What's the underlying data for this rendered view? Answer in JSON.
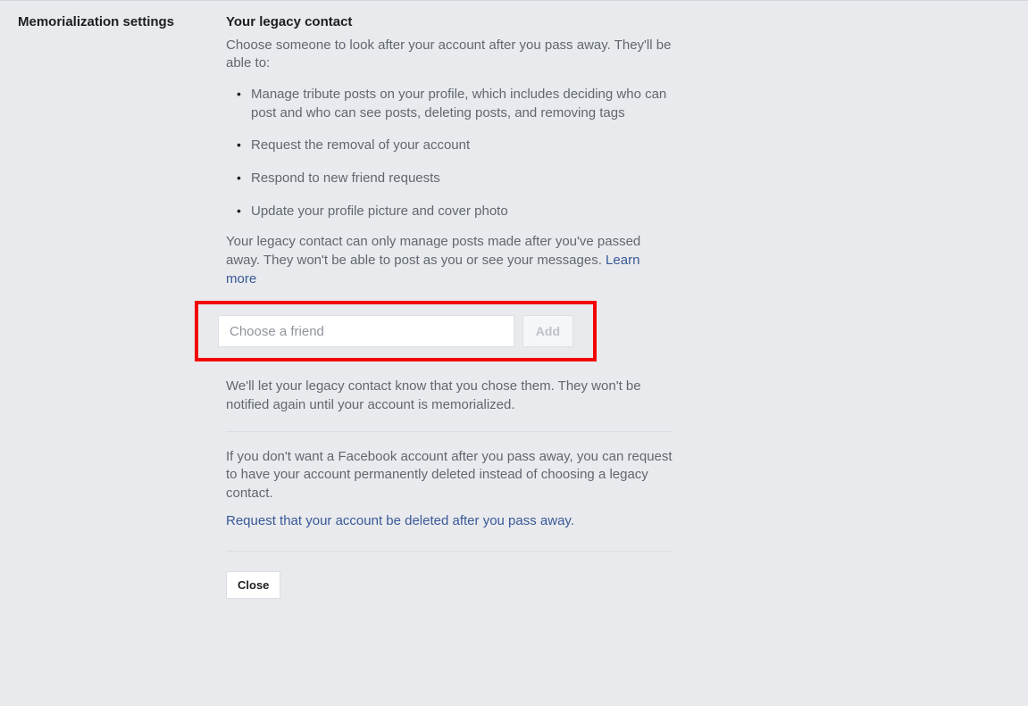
{
  "left_label": "Memorialization settings",
  "section": {
    "title": "Your legacy contact",
    "intro": "Choose someone to look after your account after you pass away. They'll be able to:",
    "permissions": [
      "Manage tribute posts on your profile, which includes deciding who can post and who can see posts, deleting posts, and removing tags",
      "Request the removal of your account",
      "Respond to new friend requests",
      "Update your profile picture and cover photo"
    ],
    "caveat": "Your legacy contact can only manage posts made after you've passed away. They won't be able to post as you or see your messages. ",
    "learn_more": "Learn more",
    "input_placeholder": "Choose a friend",
    "add_button": "Add",
    "notify_text": "We'll let your legacy contact know that you chose them. They won't be notified again until your account is memorialized.",
    "delete_intro": "If you don't want a Facebook account after you pass away, you can request to have your account permanently deleted instead of choosing a legacy contact.",
    "delete_link": "Request that your account be deleted after you pass away.",
    "close_button": "Close"
  }
}
